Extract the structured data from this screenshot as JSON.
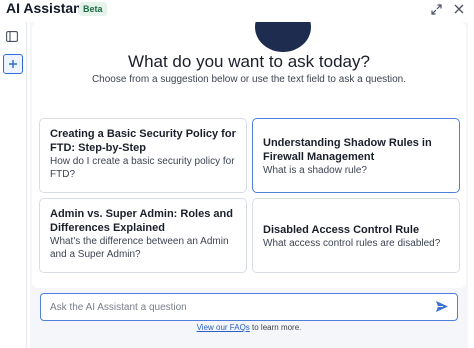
{
  "app": {
    "title": "AI Assistant",
    "badge": "Beta"
  },
  "window_controls": {
    "expand_icon": "expand-icon",
    "close_icon": "close-icon"
  },
  "sidebar": {
    "toggle_icon": "sidebar-toggle-icon",
    "new_chat_icon": "plus-icon"
  },
  "main": {
    "heading": "What do you want to ask today?",
    "subheading": "Choose from a suggestion below or use the text field to ask a question.",
    "suggestions": [
      {
        "title": "Creating a Basic Security Policy for FTD: Step-by-Step",
        "question": "How do I create a basic security policy for FTD?"
      },
      {
        "title": "Understanding Shadow Rules in Firewall Management",
        "question": "What is a shadow rule?"
      },
      {
        "title": "Admin vs. Super Admin: Roles and Differences Explained",
        "question": "What's the difference between an Admin and a Super Admin?"
      },
      {
        "title": "Disabled Access Control Rule",
        "question": "What access control rules are disabled?"
      }
    ]
  },
  "input": {
    "placeholder": "Ask the AI Assistant a question",
    "value": "",
    "send_icon": "send-icon"
  },
  "footer": {
    "link_text": "View our FAQs",
    "text": " to learn more."
  },
  "colors": {
    "accent": "#4f7fd9",
    "beta_bg": "#e6f3ec",
    "beta_text": "#1c6b43",
    "panel_bg": "#f4f6f9"
  }
}
